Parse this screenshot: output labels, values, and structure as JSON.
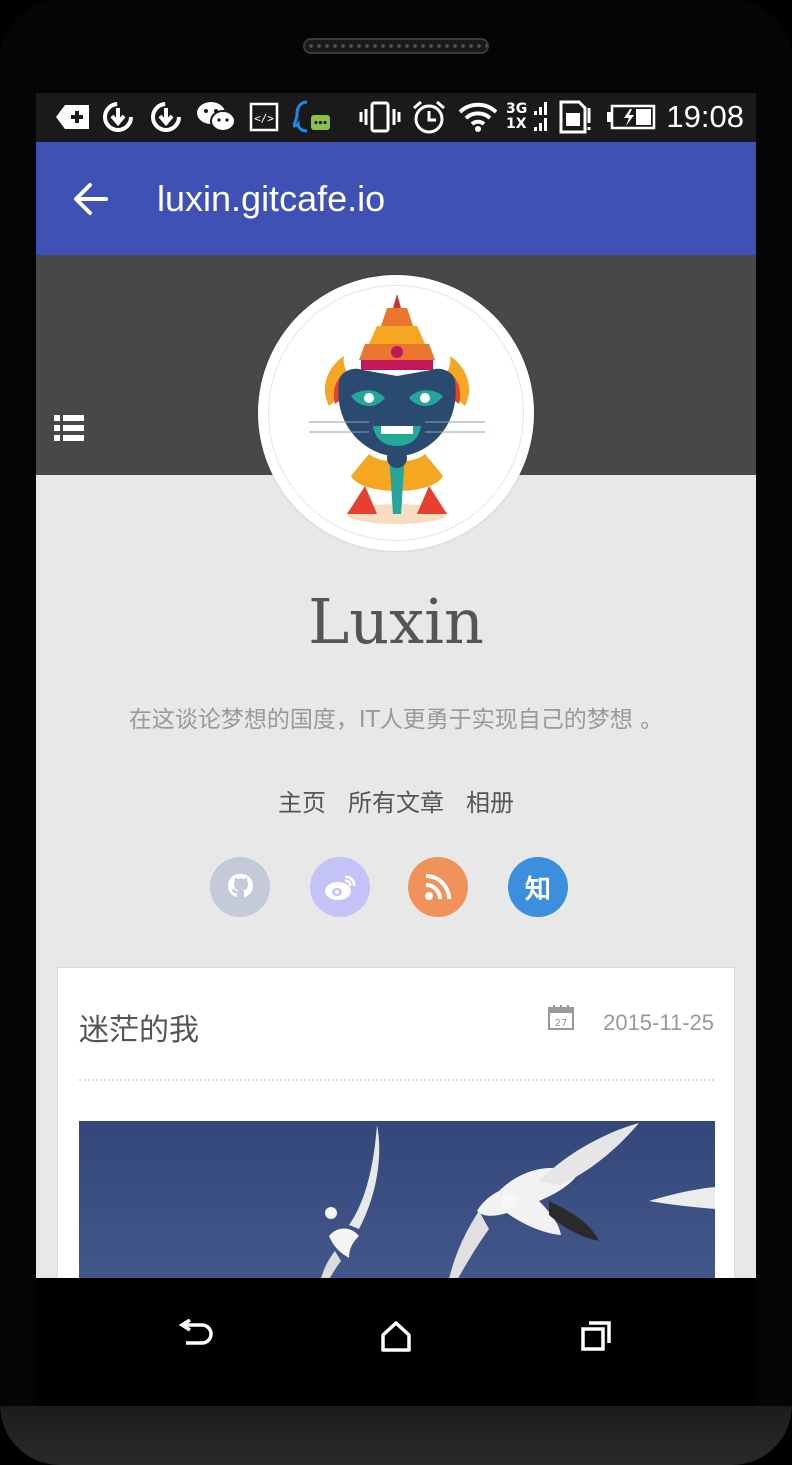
{
  "status_bar": {
    "time": "19:08",
    "icons": [
      "usb-debug-icon",
      "sync-download-icon",
      "sync-download-icon",
      "wechat-icon",
      "code-icon",
      "qq-icon",
      "vibrate-icon",
      "alarm-icon",
      "wifi-icon",
      "signal-3g-icon",
      "sim-icon",
      "battery-icon"
    ],
    "network_top": "3G",
    "network_bottom": "1X"
  },
  "app_bar": {
    "title": "luxin.gitcafe.io",
    "back_icon": "arrow-back-icon",
    "color": "#3f51b5"
  },
  "profile": {
    "name": "Luxin",
    "tagline": "在这谈论梦想的国度，IT人更勇于实现自己的梦想 。",
    "avatar": "avatar-thai-guardian-cat"
  },
  "nav": {
    "items": [
      {
        "label": "主页"
      },
      {
        "label": "所有文章"
      },
      {
        "label": "相册"
      }
    ]
  },
  "socials": [
    {
      "name": "github-icon",
      "color": "#c5cad8"
    },
    {
      "name": "weibo-icon",
      "color": "#c4c3f7"
    },
    {
      "name": "rss-icon",
      "color": "#f0935a"
    },
    {
      "name": "zhihu-icon",
      "label": "知",
      "color": "#3c8fdc"
    }
  ],
  "post": {
    "title": "迷茫的我",
    "date": "2015-11-25",
    "calendar_day": "27"
  },
  "system_nav": {
    "back_icon": "back-icon",
    "home_icon": "home-icon",
    "recents_icon": "recents-icon"
  }
}
